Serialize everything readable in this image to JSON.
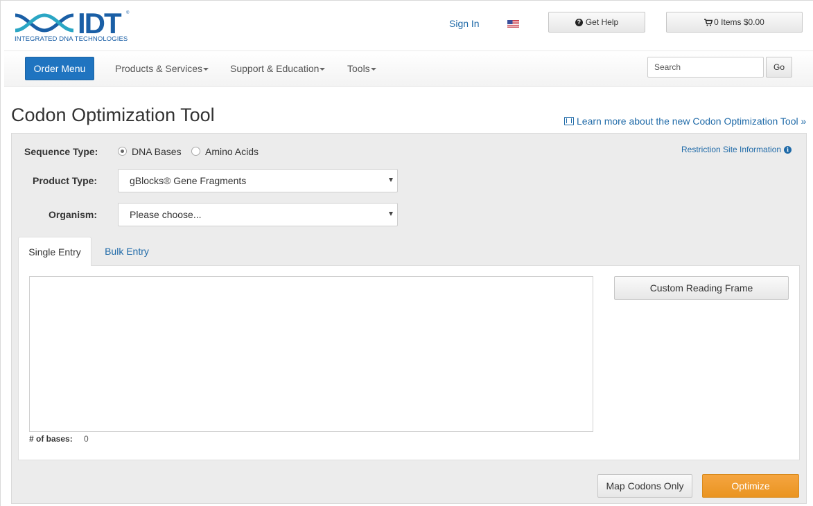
{
  "header": {
    "logo_text": "IDT",
    "logo_subtitle": "INTEGRATED DNA TECHNOLOGIES",
    "sign_in": "Sign In",
    "flag_icon": "us-flag-icon",
    "help_icon": "question-circle-icon",
    "get_help": "Get Help",
    "cart_icon": "shopping-cart-icon",
    "cart_label": "0 Items $0.00"
  },
  "nav": {
    "order_menu": "Order Menu",
    "products": "Products & Services",
    "support": "Support & Education",
    "tools": "Tools",
    "search_placeholder": "Search",
    "go": "Go"
  },
  "page": {
    "title": "Codon Optimization Tool",
    "learn_more": "Learn more about the new Codon Optimization Tool »"
  },
  "form": {
    "sequence_type_label": "Sequence Type:",
    "sequence_options": [
      {
        "label": "DNA Bases",
        "checked": true
      },
      {
        "label": "Amino Acids",
        "checked": false
      }
    ],
    "restriction_link": "Restriction Site Information",
    "product_type_label": "Product Type:",
    "product_type_value": "gBlocks® Gene Fragments",
    "organism_label": "Organism:",
    "organism_value": "Please choose..."
  },
  "tabs": [
    {
      "label": "Single Entry",
      "active": true
    },
    {
      "label": "Bulk Entry",
      "active": false
    }
  ],
  "entry": {
    "sequence_value": "",
    "bases_label": "# of bases:",
    "bases_count": "0",
    "custom_reading_frame": "Custom Reading Frame"
  },
  "actions": {
    "map_codons": "Map Codons Only",
    "optimize": "Optimize"
  },
  "colors": {
    "brand_blue": "#1f74c0",
    "link_blue": "#1f6aa8",
    "optimize_orange": "#ea9421",
    "panel_gray": "#ececec"
  }
}
